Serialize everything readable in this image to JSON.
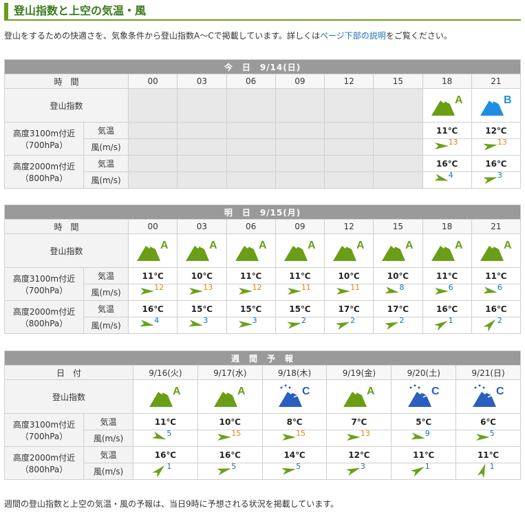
{
  "heading": "登山指数と上空の気温・風",
  "intro": {
    "pre": "登山をするための快適さを、気象条件から登山指数A～Cで掲載しています。詳しくは",
    "link": "ページ下部の説明",
    "post": "をご覧ください。"
  },
  "labels": {
    "time": "時　間",
    "date": "日　付",
    "index": "登山指数",
    "alt1": "高度3100m付近",
    "alt1_hpa": "（700hPa）",
    "alt2": "高度2000m付近",
    "alt2_hpa": "（800hPa）",
    "temp": "気温",
    "wind": "風(m/s)"
  },
  "today": {
    "header": "今　日　9/14(日)",
    "times": [
      "00",
      "03",
      "06",
      "09",
      "12",
      "15",
      "18",
      "21"
    ],
    "index": [
      "",
      "",
      "",
      "",
      "",
      "",
      "A",
      "B"
    ],
    "t700": [
      "",
      "",
      "",
      "",
      "",
      "",
      "11℃",
      "12℃"
    ],
    "w700": [
      null,
      null,
      null,
      null,
      null,
      null,
      {
        "v": "13",
        "dir": 0,
        "c": "o"
      },
      {
        "v": "13",
        "dir": -10,
        "c": "o"
      }
    ],
    "t800": [
      "",
      "",
      "",
      "",
      "",
      "",
      "16℃",
      "16℃"
    ],
    "w800": [
      null,
      null,
      null,
      null,
      null,
      null,
      {
        "v": "4",
        "dir": 15,
        "c": "b"
      },
      {
        "v": "3",
        "dir": -15,
        "c": "b"
      }
    ]
  },
  "tomorrow": {
    "header": "明　日　9/15(月)",
    "times": [
      "00",
      "03",
      "06",
      "09",
      "12",
      "15",
      "18",
      "21"
    ],
    "index": [
      "A",
      "A",
      "A",
      "A",
      "A",
      "A",
      "A",
      "A"
    ],
    "t700": [
      "11℃",
      "10℃",
      "11℃",
      "11℃",
      "10℃",
      "10℃",
      "11℃",
      "11℃"
    ],
    "w700": [
      {
        "v": "12",
        "dir": 0,
        "c": "o"
      },
      {
        "v": "13",
        "dir": 0,
        "c": "o"
      },
      {
        "v": "12",
        "dir": 0,
        "c": "o"
      },
      {
        "v": "11",
        "dir": 0,
        "c": "o"
      },
      {
        "v": "11",
        "dir": 0,
        "c": "o"
      },
      {
        "v": "8",
        "dir": 10,
        "c": "b"
      },
      {
        "v": "6",
        "dir": 0,
        "c": "b"
      },
      {
        "v": "6",
        "dir": 10,
        "c": "b"
      }
    ],
    "t800": [
      "16℃",
      "15℃",
      "15℃",
      "15℃",
      "17℃",
      "17℃",
      "16℃",
      "16℃"
    ],
    "w800": [
      {
        "v": "4",
        "dir": 10,
        "c": "b"
      },
      {
        "v": "3",
        "dir": 10,
        "c": "b"
      },
      {
        "v": "3",
        "dir": 0,
        "c": "b"
      },
      {
        "v": "2",
        "dir": -10,
        "c": "b"
      },
      {
        "v": "2",
        "dir": -20,
        "c": "b"
      },
      {
        "v": "2",
        "dir": -20,
        "c": "b"
      },
      {
        "v": "1",
        "dir": -30,
        "c": "b"
      },
      {
        "v": "2",
        "dir": -45,
        "c": "b"
      }
    ]
  },
  "weekly": {
    "header": "週　間　予　報",
    "dates": [
      "9/16(火)",
      "9/17(水)",
      "9/18(木)",
      "9/19(金)",
      "9/20(土)",
      "9/21(日)"
    ],
    "index": [
      "A",
      "A",
      "C",
      "A",
      "C",
      "C"
    ],
    "t700": [
      "11℃",
      "10℃",
      "8℃",
      "7℃",
      "5℃",
      "6℃"
    ],
    "w700": [
      {
        "v": "5",
        "dir": 20,
        "c": "b"
      },
      {
        "v": "15",
        "dir": 0,
        "c": "o"
      },
      {
        "v": "15",
        "dir": 0,
        "c": "o"
      },
      {
        "v": "13",
        "dir": 0,
        "c": "o"
      },
      {
        "v": "9",
        "dir": 10,
        "c": "b"
      },
      {
        "v": "5",
        "dir": 0,
        "c": "b"
      }
    ],
    "t800": [
      "16℃",
      "16℃",
      "14℃",
      "12℃",
      "11℃",
      "11℃"
    ],
    "w800": [
      {
        "v": "1",
        "dir": -45,
        "c": "b"
      },
      {
        "v": "5",
        "dir": -15,
        "c": "b"
      },
      {
        "v": "5",
        "dir": -10,
        "c": "b"
      },
      {
        "v": "3",
        "dir": -20,
        "c": "b"
      },
      {
        "v": "1",
        "dir": -30,
        "c": "b"
      },
      {
        "v": "1",
        "dir": -70,
        "c": "b"
      }
    ]
  },
  "footer": "週間の登山指数と上空の気温・風の予報は、当日9時に予想される状況を掲載しています。",
  "colors": {
    "accent": "#6b9c1e",
    "header_bg": "#9a9a9a",
    "rank_a": "#6a9e16",
    "rank_b": "#1f8ee0",
    "rank_c": "#2a5fbf",
    "wind_strong": "#e08a10",
    "wind_weak": "#1a6ebd"
  }
}
